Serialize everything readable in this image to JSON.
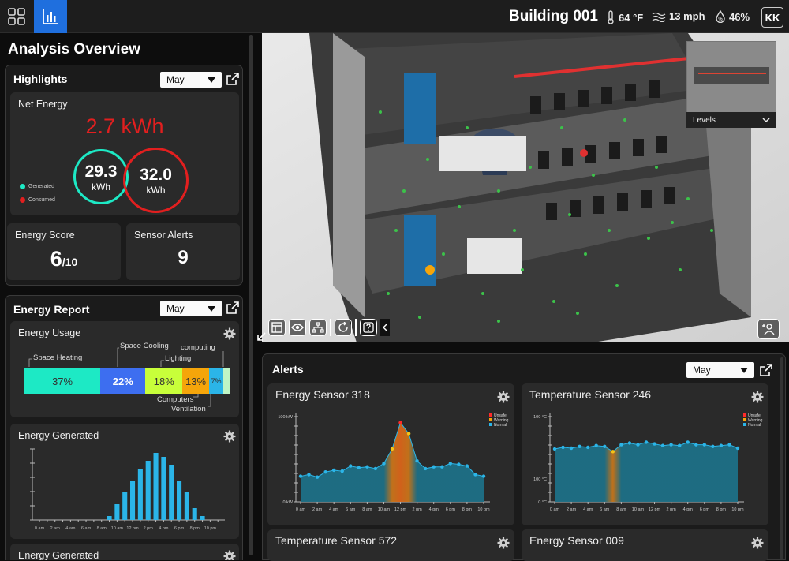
{
  "topbar": {
    "building": "Building 001",
    "temperature": "64 °F",
    "wind": "13 mph",
    "humidity": "46%",
    "user_initials": "KK"
  },
  "left": {
    "title": "Analysis Overview",
    "highlights": {
      "title": "Highlights",
      "month": "May",
      "net_energy_label": "Net Energy",
      "net_energy_value": "2.7 kWh",
      "generated_value": "29.3",
      "consumed_value": "32.0",
      "unit": "kWh",
      "legend_generated": "Generated",
      "legend_consumed": "Consumed",
      "energy_score_label": "Energy Score",
      "energy_score_value": "6",
      "energy_score_denom": "/10",
      "sensor_alerts_label": "Sensor Alerts",
      "sensor_alerts_value": "9"
    },
    "energy_report": {
      "title": "Energy Report",
      "month": "May",
      "usage_title": "Energy Usage",
      "usage_labels": {
        "space_heating": "Space Heating",
        "space_cooling": "Space Cooling",
        "computing": "computing",
        "lighting": "Lighting",
        "computers": "Computers",
        "ventilation": "Ventilation"
      },
      "usage_segments": [
        {
          "name": "Space Heating",
          "label": "37%",
          "pct": 37,
          "color": "#1de9c5"
        },
        {
          "name": "Space Cooling",
          "label": "22%",
          "pct": 22,
          "color": "#3d6ef0"
        },
        {
          "name": "Lighting",
          "label": "18%",
          "pct": 18,
          "color": "#c8ff3a"
        },
        {
          "name": "Computers",
          "label": "13%",
          "pct": 13,
          "color": "#f5a50a"
        },
        {
          "name": "Ventilation",
          "label": "7%",
          "pct": 7,
          "color": "#2bb5e8"
        },
        {
          "name": "computing",
          "label": "",
          "pct": 3,
          "color": "#bff5c5"
        }
      ],
      "generated_title": "Energy Generated",
      "generated_title_2": "Energy Generated"
    }
  },
  "viewer": {
    "levels_label": "Levels"
  },
  "alerts": {
    "title": "Alerts",
    "month": "May",
    "legend": [
      "Unsafe",
      "Warning",
      "Normal"
    ],
    "legend_colors": [
      "#ff2a2a",
      "#f5a50a",
      "#2bb5e8"
    ],
    "cards": [
      {
        "title": "Energy Sensor 318",
        "y_top": "100 kW",
        "y_bottom": "0 kW",
        "y_mid": ""
      },
      {
        "title": "Temperature Sensor 246",
        "y_top": "100 °C",
        "y_bottom": "0 °C",
        "y_mid": "100 °C"
      },
      {
        "title": "Temperature Sensor 572"
      },
      {
        "title": "Energy Sensor 009"
      }
    ],
    "x_ticks": [
      "0 am",
      "2 am",
      "4 am",
      "6 am",
      "8 am",
      "10 am",
      "12 pm",
      "2 pm",
      "4 pm",
      "6 pm",
      "8 pm",
      "10 pm"
    ]
  },
  "chart_data": [
    {
      "type": "bar",
      "title": "Energy Generated",
      "categories": [
        "0 am",
        "2 am",
        "4 am",
        "6 am",
        "8 am",
        "10 am",
        "12 pm",
        "2 pm",
        "4 pm",
        "6 pm",
        "8 pm",
        "10 pm"
      ],
      "x_hours": [
        0,
        1,
        2,
        3,
        4,
        5,
        6,
        7,
        8,
        9,
        10,
        11,
        12,
        13,
        14,
        15,
        16,
        17,
        18,
        19,
        20,
        21,
        22,
        23
      ],
      "values": [
        0,
        0,
        0,
        0,
        0,
        0,
        0,
        0,
        0,
        1,
        4,
        7,
        10,
        13,
        15,
        17,
        16,
        14,
        10,
        7,
        3,
        1,
        0,
        0
      ],
      "ylim": [
        0,
        18
      ]
    },
    {
      "type": "area",
      "title": "Energy Sensor 318",
      "x": [
        "0 am",
        "1",
        "2 am",
        "3",
        "4 am",
        "5",
        "6 am",
        "7",
        "8 am",
        "9",
        "10 am",
        "11",
        "12 pm",
        "1 pm",
        "2 pm",
        "3",
        "4 pm",
        "5",
        "6 pm",
        "7",
        "8 pm",
        "9",
        "10 pm"
      ],
      "values": [
        30,
        32,
        29,
        35,
        37,
        36,
        42,
        40,
        41,
        39,
        45,
        62,
        93,
        80,
        48,
        39,
        41,
        41,
        45,
        44,
        42,
        32,
        30
      ],
      "status": [
        "normal",
        "normal",
        "normal",
        "normal",
        "normal",
        "normal",
        "normal",
        "normal",
        "normal",
        "normal",
        "normal",
        "warning",
        "unsafe",
        "warning",
        "normal",
        "normal",
        "normal",
        "normal",
        "normal",
        "normal",
        "normal",
        "normal",
        "normal"
      ],
      "ylim": [
        0,
        100
      ]
    },
    {
      "type": "area",
      "title": "Temperature Sensor 246",
      "x": [
        "0 am",
        "1",
        "2 am",
        "3",
        "4 am",
        "5",
        "6 am",
        "7",
        "8 am",
        "9",
        "10 am",
        "11",
        "12 pm",
        "1 pm",
        "2 pm",
        "3",
        "4 pm",
        "5",
        "6 pm",
        "7",
        "8 pm",
        "9",
        "10 pm"
      ],
      "values": [
        62,
        64,
        63,
        65,
        64,
        66,
        65,
        59,
        67,
        69,
        67,
        70,
        68,
        66,
        67,
        66,
        70,
        67,
        67,
        65,
        66,
        67,
        63
      ],
      "status": [
        "normal",
        "normal",
        "normal",
        "normal",
        "normal",
        "normal",
        "normal",
        "warning",
        "normal",
        "normal",
        "normal",
        "normal",
        "normal",
        "normal",
        "normal",
        "normal",
        "normal",
        "normal",
        "normal",
        "normal",
        "normal",
        "normal",
        "normal"
      ],
      "ylim": [
        0,
        100
      ]
    }
  ]
}
